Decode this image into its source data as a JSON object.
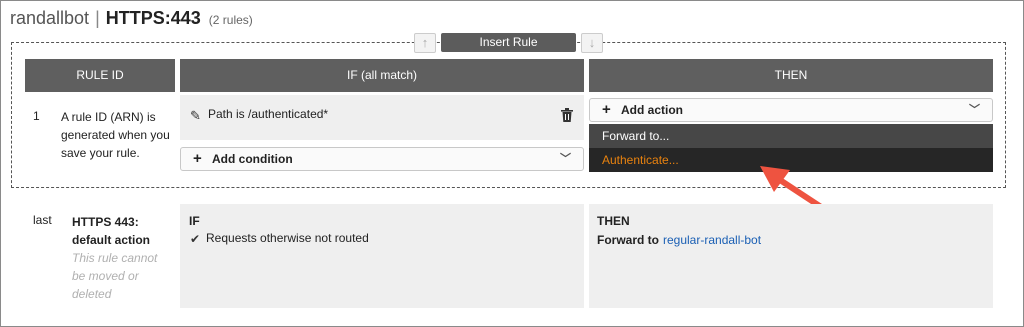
{
  "header": {
    "lb_name": "randallbot",
    "separator": "|",
    "listener": "HTTPS:443",
    "rule_count": "(2 rules)"
  },
  "toolbar": {
    "move_up_icon": "arrow-up-icon",
    "insert_rule": "Insert Rule",
    "move_down_icon": "arrow-down-icon"
  },
  "table": {
    "columns": [
      "RULE ID",
      "IF (all match)",
      "THEN"
    ]
  },
  "rule": {
    "number": "1",
    "description": "A rule ID (ARN) is generated when you save your rule.",
    "condition": "Path is /authenticated*",
    "add_condition": "Add condition",
    "add_action": "Add action",
    "action_menu": [
      "Forward to...",
      "Authenticate..."
    ]
  },
  "default_rule": {
    "position": "last",
    "title": "HTTPS 443: default action",
    "note": "This rule cannot be moved or deleted",
    "if_label": "IF",
    "if_text": "Requests otherwise not routed",
    "then_label": "THEN",
    "forward_label": "Forward to",
    "target_group": "regular-randall-bot"
  },
  "colors": {
    "header_bg": "#5f5f5f",
    "menu_bg": "#2e2e2e",
    "highlight": "#e8820f",
    "link": "#1a5fb4",
    "annotation_arrow": "#ee5340"
  }
}
